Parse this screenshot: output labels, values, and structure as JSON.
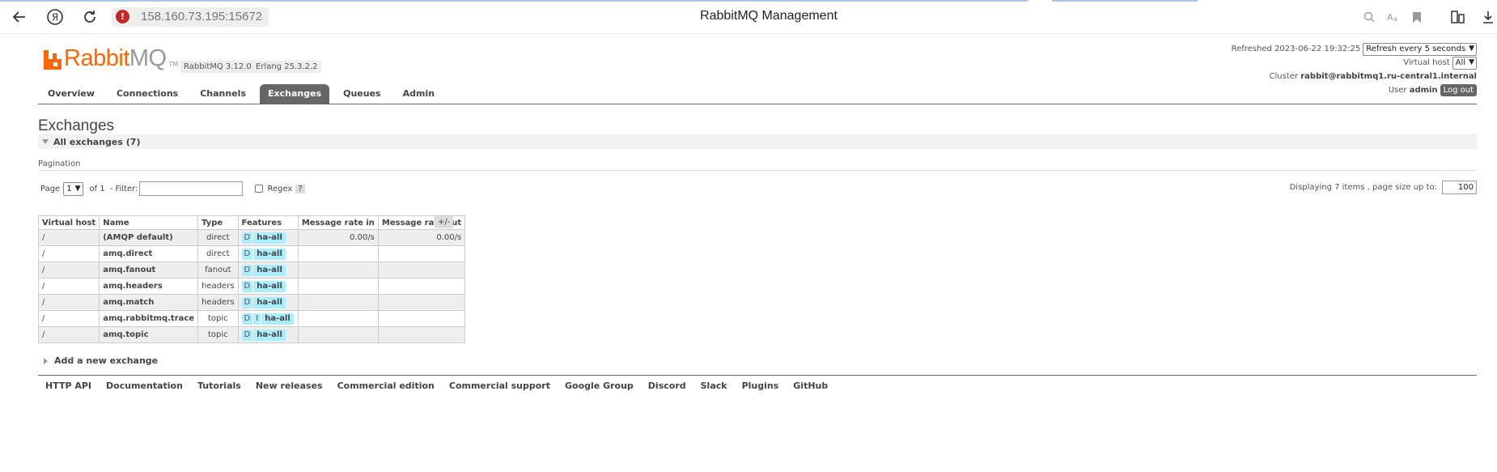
{
  "browser": {
    "url": "158.160.73.195:15672",
    "title": "RabbitMQ Management",
    "ya_label": "Я"
  },
  "header": {
    "logo_rabbit": "Rabbit",
    "logo_mq": "MQ",
    "logo_tm": "TM",
    "rabbitmq_version": "RabbitMQ 3.12.0",
    "erlang_version": "Erlang 25.3.2.2",
    "refreshed_label": "Refreshed",
    "refreshed_time": "2023-06-22 19:32:25",
    "refresh_select": "Refresh every 5 seconds",
    "vhost_label": "Virtual host",
    "vhost_select": "All",
    "cluster_label": "Cluster",
    "cluster_name": "rabbit@rabbitmq1.ru-central1.internal",
    "user_label": "User",
    "user_name": "admin",
    "logout_label": "Log out"
  },
  "tabs": [
    {
      "label": "Overview"
    },
    {
      "label": "Connections"
    },
    {
      "label": "Channels"
    },
    {
      "label": "Exchanges",
      "active": true
    },
    {
      "label": "Queues"
    },
    {
      "label": "Admin"
    }
  ],
  "main": {
    "title": "Exchanges",
    "section_label": "All exchanges (7)",
    "pagination_label": "Pagination",
    "page_label": "Page",
    "page_value": "1",
    "of_label": "of 1",
    "filter_label": "- Filter:",
    "filter_value": "",
    "regex_label": "Regex",
    "help_label": "?",
    "displaying_label": "Displaying 7 items , page size up to:",
    "page_size": "100",
    "plus_minus": "+/-",
    "add_exchange_label": "Add a new exchange"
  },
  "table": {
    "columns": [
      "Virtual host",
      "Name",
      "Type",
      "Features",
      "Message rate in",
      "Message rate out"
    ],
    "rows": [
      {
        "vhost": "/",
        "name": "(AMQP default)",
        "type": "direct",
        "features": [
          "D"
        ],
        "policy": "ha-all",
        "rate_in": "0.00/s",
        "rate_out": "0.00/s"
      },
      {
        "vhost": "/",
        "name": "amq.direct",
        "type": "direct",
        "features": [
          "D"
        ],
        "policy": "ha-all",
        "rate_in": "",
        "rate_out": ""
      },
      {
        "vhost": "/",
        "name": "amq.fanout",
        "type": "fanout",
        "features": [
          "D"
        ],
        "policy": "ha-all",
        "rate_in": "",
        "rate_out": ""
      },
      {
        "vhost": "/",
        "name": "amq.headers",
        "type": "headers",
        "features": [
          "D"
        ],
        "policy": "ha-all",
        "rate_in": "",
        "rate_out": ""
      },
      {
        "vhost": "/",
        "name": "amq.match",
        "type": "headers",
        "features": [
          "D"
        ],
        "policy": "ha-all",
        "rate_in": "",
        "rate_out": ""
      },
      {
        "vhost": "/",
        "name": "amq.rabbitmq.trace",
        "type": "topic",
        "features": [
          "D",
          "I"
        ],
        "policy": "ha-all",
        "rate_in": "",
        "rate_out": ""
      },
      {
        "vhost": "/",
        "name": "amq.topic",
        "type": "topic",
        "features": [
          "D"
        ],
        "policy": "ha-all",
        "rate_in": "",
        "rate_out": ""
      }
    ]
  },
  "footer": [
    "HTTP API",
    "Documentation",
    "Tutorials",
    "New releases",
    "Commercial edition",
    "Commercial support",
    "Google Group",
    "Discord",
    "Slack",
    "Plugins",
    "GitHub"
  ],
  "colors": {
    "brand": "#ff6600",
    "tab_active": "#666666",
    "feature_badge": "#aaeeff",
    "warning": "#c62828"
  }
}
